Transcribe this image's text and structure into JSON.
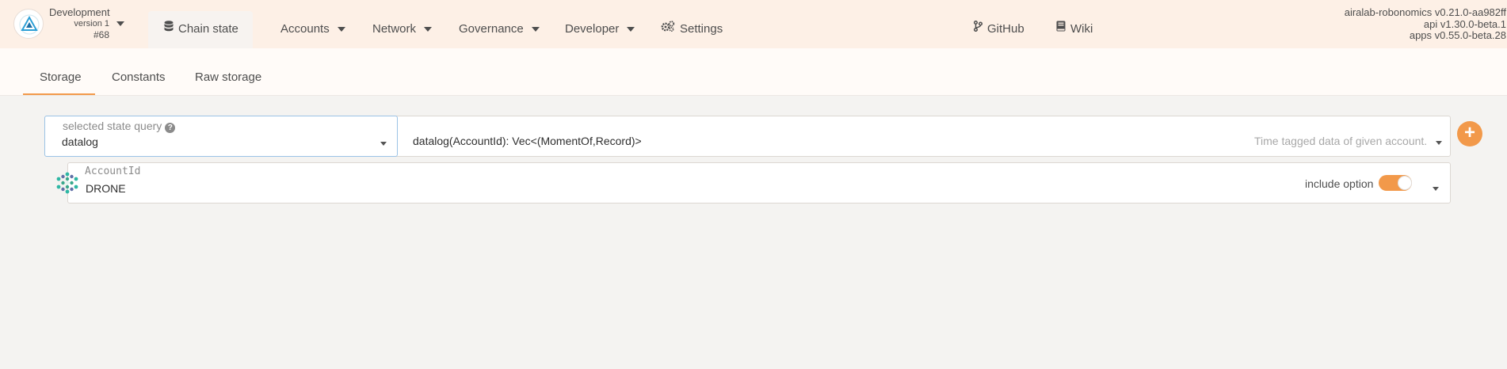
{
  "header": {
    "chain_name": "Development",
    "chain_version": "version 1",
    "block": "#68",
    "nav": [
      {
        "label": "Chain state"
      },
      {
        "label": "Accounts"
      },
      {
        "label": "Network"
      },
      {
        "label": "Governance"
      },
      {
        "label": "Developer"
      },
      {
        "label": "Settings"
      }
    ],
    "links": [
      {
        "label": "GitHub"
      },
      {
        "label": "Wiki"
      }
    ],
    "versions": [
      "airalab-robonomics v0.21.0-aa982ff",
      "api v1.30.0-beta.1",
      "apps v0.55.0-beta.28"
    ]
  },
  "tabs": [
    {
      "label": "Storage",
      "active": true
    },
    {
      "label": "Constants",
      "active": false
    },
    {
      "label": "Raw storage",
      "active": false
    }
  ],
  "query": {
    "label": "selected state query",
    "value": "datalog",
    "signature": "datalog(AccountId): Vec<(MomentOf,Record)>",
    "description": "Time tagged data of given account."
  },
  "account": {
    "label": "AccountId",
    "value": "DRONE",
    "option_label": "include option",
    "option_enabled": true
  },
  "colors": {
    "accent": "#f2994a",
    "header_bg": "#fdf0e6",
    "page_bg": "#f4f3f1"
  }
}
